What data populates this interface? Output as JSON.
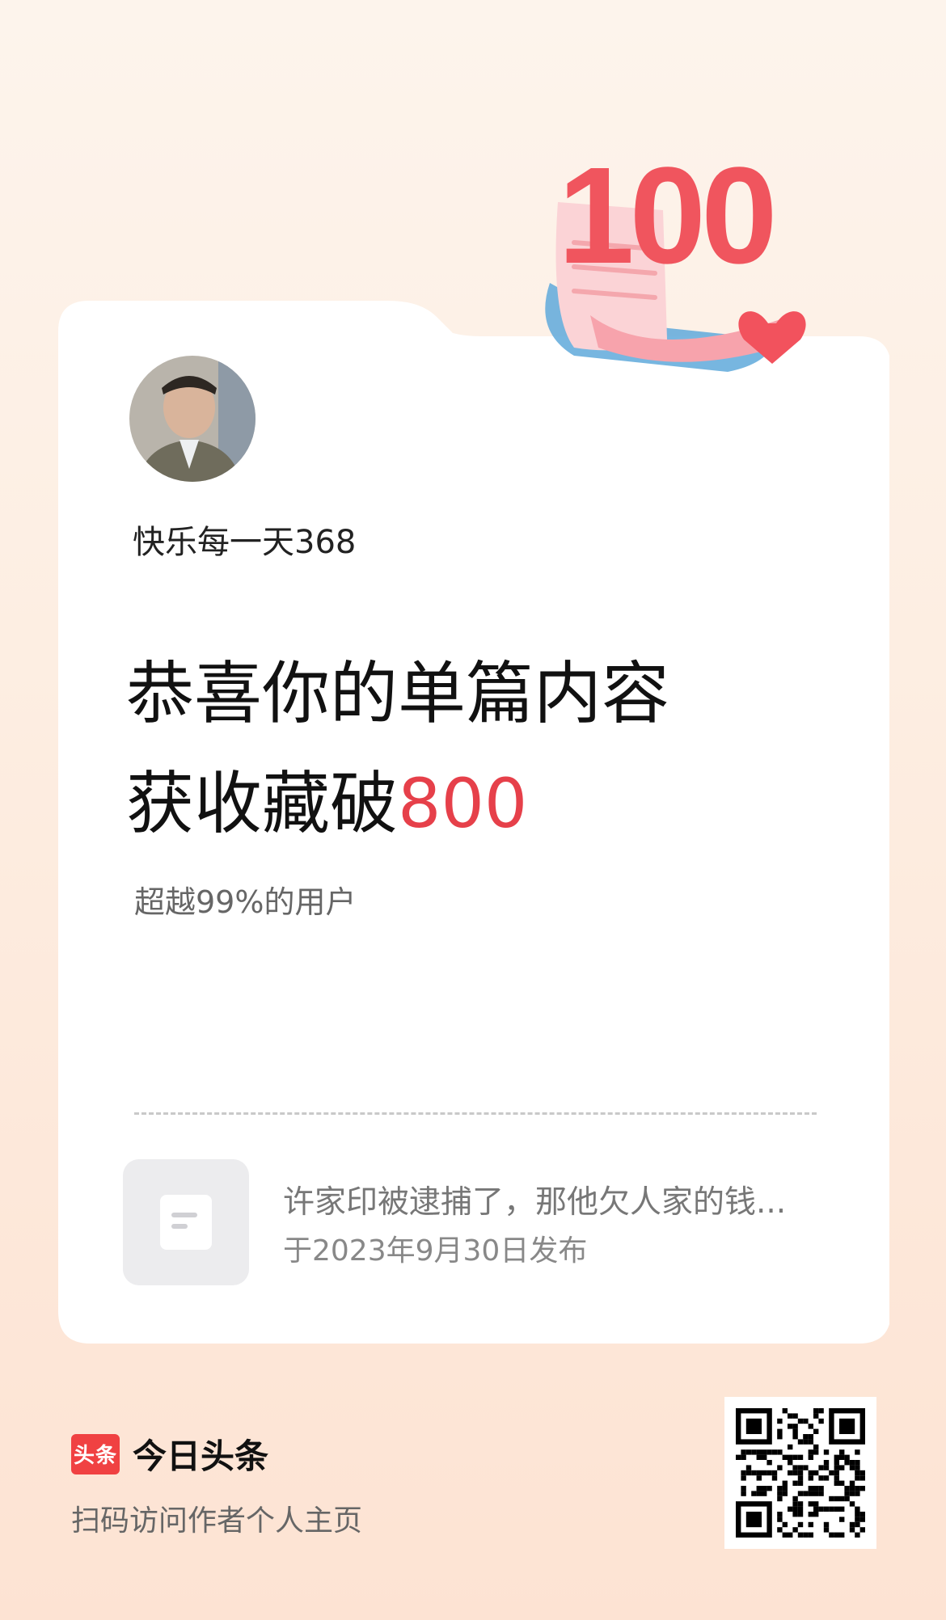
{
  "badge": {
    "number": "100"
  },
  "profile": {
    "username": "快乐每一天368"
  },
  "headline": {
    "line1": "恭喜你的单篇内容",
    "line2_prefix": "获收藏破",
    "line2_number": "800"
  },
  "subtext": "超越99%的用户",
  "article": {
    "title": "许家印被逮捕了，那他欠人家的钱...",
    "date": "于2023年9月30日发布"
  },
  "footer": {
    "logo_text": "头条",
    "app_name": "今日头条",
    "scan_text": "扫码访问作者个人主页"
  },
  "colors": {
    "accent": "#e6404a",
    "brand": "#f04142"
  }
}
